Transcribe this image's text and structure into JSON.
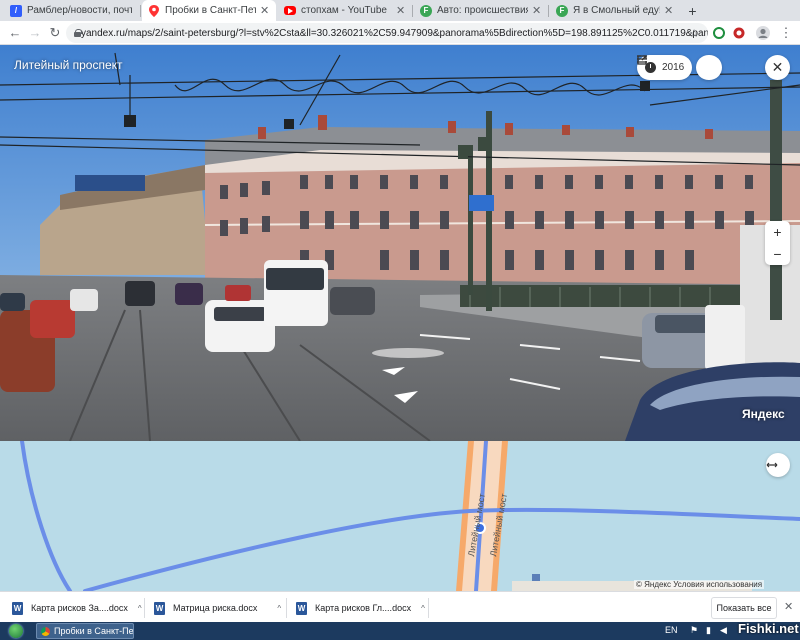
{
  "browser": {
    "tabs": [
      {
        "title": "Рамблер/новости, почта и",
        "icon": "rambler-icon",
        "color": "#315efb",
        "glyph": "/",
        "active": false
      },
      {
        "title": "Пробки в Санкт-Петербург",
        "icon": "yandex-maps-icon",
        "color": "#ff3333",
        "glyph": "",
        "active": true
      },
      {
        "title": "стопхам - YouTube",
        "icon": "youtube-icon",
        "color": "#ff0000",
        "glyph": "",
        "active": false
      },
      {
        "title": "Авто: происшествия на дор",
        "icon": "fontanka-icon",
        "color": "#3aa655",
        "glyph": "F",
        "active": false
      },
      {
        "title": "Я в Смольный еду! - конф",
        "icon": "fontanka-icon",
        "color": "#3aa655",
        "glyph": "F",
        "active": false
      }
    ],
    "new_tab_label": "+",
    "url": "yandex.ru/maps/2/saint-petersburg/?l=stv%2Csta&ll=30.326021%2C59.947909&panorama%5Bdirection%5D=198.891125%2C0.011719&panorama%5"
  },
  "panorama": {
    "street_name": "Литейный проспект",
    "year": "2016",
    "zoom_in": "+",
    "zoom_out": "−",
    "brand": "Яндекс"
  },
  "map": {
    "bridge_label_1": "Литейный мост",
    "bridge_label_2": "Литейный мост",
    "copyright": "© Яндекс Условия использования"
  },
  "downloads": {
    "items": [
      {
        "name": "Карта рисков За....docx"
      },
      {
        "name": "Матрица риска.docx"
      },
      {
        "name": "Карта рисков Гл....docx"
      }
    ],
    "show_all": "Показать все"
  },
  "taskbar": {
    "window_title": "Пробки в Санкт-Пе...",
    "language": "EN"
  },
  "watermark": "Fishki.net",
  "colors": {
    "river": "#b9dbe8",
    "road": "#6b8ee8",
    "bridge": "#f6a96a",
    "taskbar": "#1c3a5f"
  }
}
